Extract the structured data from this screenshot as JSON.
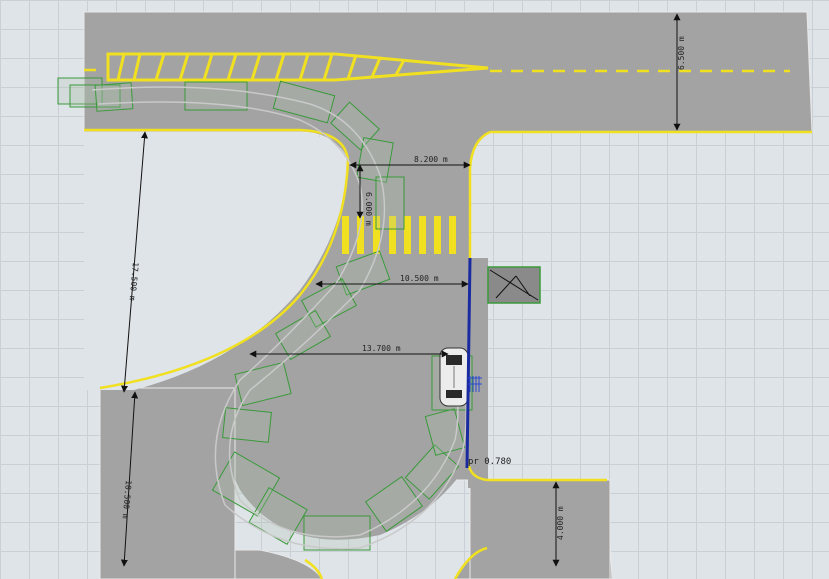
{
  "scene": {
    "colors": {
      "road": "#a3a3a3",
      "lane_marking": "#f0e020",
      "outline": "#e8e8e8",
      "vehicle_path": "#3a9a3a",
      "pole": "#1a2aa0",
      "dimension_line": "#111111"
    },
    "dimensions": {
      "top_road_width": "6.500 m",
      "crosswalk_offset": "8.200 m",
      "curb_offset_short": "6.000 m",
      "median_to_pole": "10.500 m",
      "left_block_span": "17.500 m",
      "median_to_vehicle": "13.700 m",
      "lower_road_width": "10.500 m",
      "right_road_width": "4.000 m"
    },
    "annotations": {
      "pole_label": "pr 0.780"
    },
    "icons": {
      "vehicle": "car-icon",
      "sign": "sign-icon"
    }
  }
}
